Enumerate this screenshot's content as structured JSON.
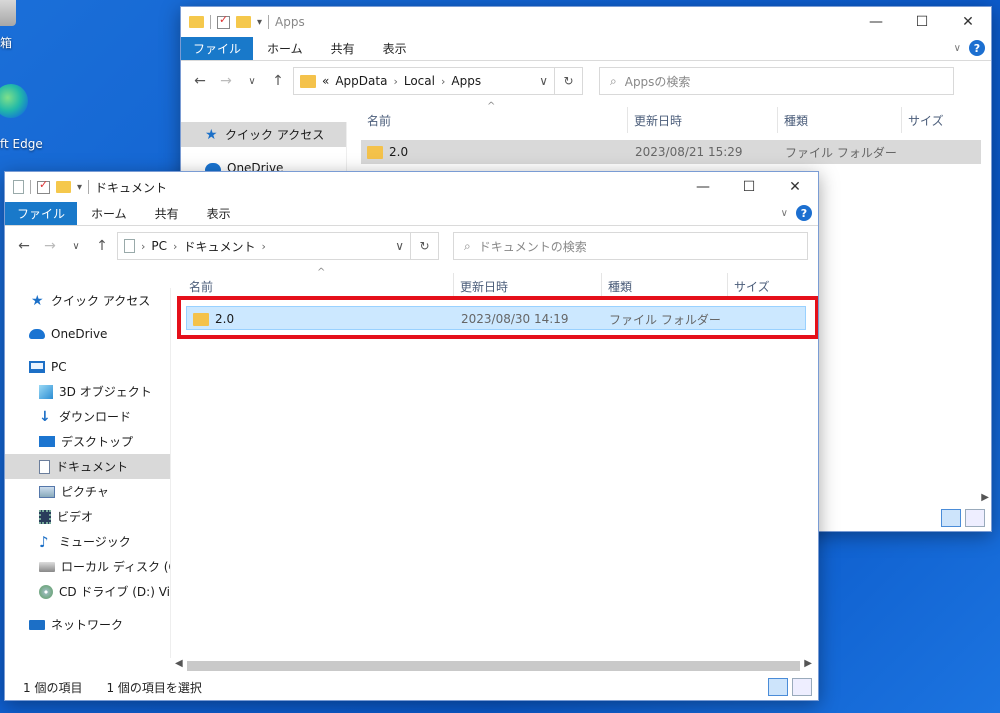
{
  "desktop": {
    "icon_label_partial": "ft Edge",
    "bin_label_partial": "箱"
  },
  "back_window": {
    "title": "Apps",
    "ribbon": {
      "file": "ファイル",
      "tabs": [
        "ホーム",
        "共有",
        "表示"
      ]
    },
    "address": {
      "prefix": "«",
      "crumbs": [
        "AppData",
        "Local",
        "Apps"
      ]
    },
    "search_placeholder": "Appsの検索",
    "columns": [
      "名前",
      "更新日時",
      "種類",
      "サイズ"
    ],
    "sidebar": [
      "クイック アクセス",
      "OneDrive"
    ],
    "rows": [
      {
        "name": "2.0",
        "modified": "2023/08/21 15:29",
        "type": "ファイル フォルダー",
        "size": ""
      }
    ]
  },
  "front_window": {
    "title": "ドキュメント",
    "ribbon": {
      "file": "ファイル",
      "tabs": [
        "ホーム",
        "共有",
        "表示"
      ]
    },
    "address": {
      "crumbs": [
        "PC",
        "ドキュメント"
      ]
    },
    "search_placeholder": "ドキュメントの検索",
    "columns": [
      "名前",
      "更新日時",
      "種類",
      "サイズ"
    ],
    "sidebar": {
      "quick_access": "クイック アクセス",
      "onedrive": "OneDrive",
      "pc": "PC",
      "pc_items": [
        "3D オブジェクト",
        "ダウンロード",
        "デスクトップ",
        "ドキュメント",
        "ピクチャ",
        "ビデオ",
        "ミュージック",
        "ローカル ディスク (C:)",
        "CD ドライブ (D:) Virtu"
      ],
      "network": "ネットワーク"
    },
    "rows": [
      {
        "name": "2.0",
        "modified": "2023/08/30 14:19",
        "type": "ファイル フォルダー",
        "size": ""
      }
    ],
    "status": {
      "count": "1 個の項目",
      "selected": "1 個の項目を選択"
    }
  },
  "colors": {
    "ribbon_file": "#1979ca",
    "selection": "#cce8ff",
    "highlight_box": "#e5101a"
  }
}
